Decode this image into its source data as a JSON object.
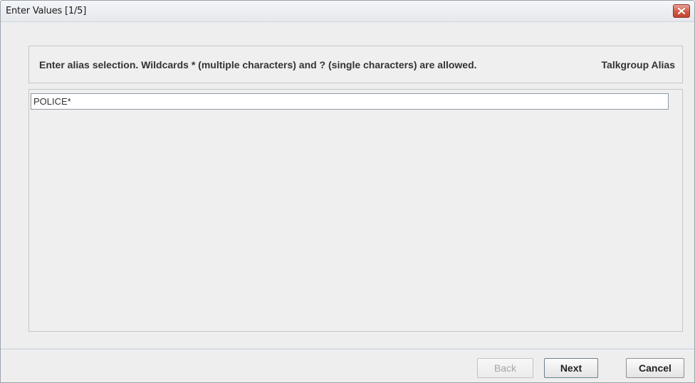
{
  "window": {
    "title": "Enter Values [1/5]"
  },
  "header": {
    "instruction": "Enter alias selection. Wildcards * (multiple characters) and ? (single characters) are allowed.",
    "field_label": "Talkgroup Alias"
  },
  "content": {
    "alias_input_value": "POLICE*"
  },
  "buttons": {
    "back_label": "Back",
    "back_enabled": false,
    "next_label": "Next",
    "cancel_label": "Cancel"
  },
  "icons": {
    "close": "close-icon"
  },
  "colors": {
    "close_button": "#c9503c",
    "window_background": "#eeeeee"
  }
}
